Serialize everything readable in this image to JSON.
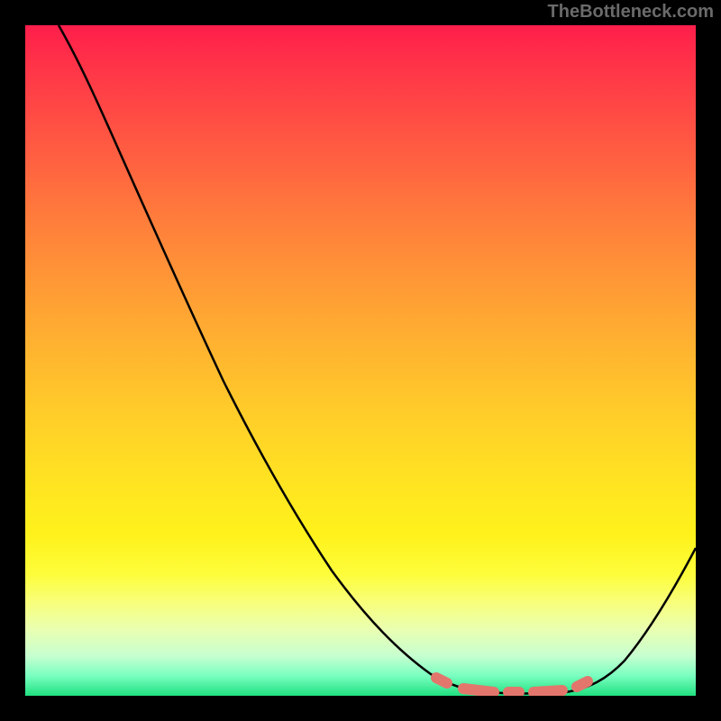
{
  "watermark": "TheBottleneck.com",
  "chart_data": {
    "type": "line",
    "title": "",
    "xlabel": "",
    "ylabel": "",
    "xlim": [
      0,
      100
    ],
    "ylim": [
      0,
      100
    ],
    "grid": false,
    "legend": false,
    "series": [
      {
        "name": "bottleneck-curve",
        "color": "#000000",
        "x": [
          5,
          10,
          15,
          20,
          25,
          30,
          35,
          40,
          45,
          50,
          55,
          60,
          63,
          66,
          70,
          74,
          78,
          82,
          85,
          90,
          95,
          100
        ],
        "values": [
          100,
          93,
          85,
          77,
          69,
          61,
          53,
          45,
          37,
          29,
          21,
          13,
          8,
          5,
          2,
          1,
          1,
          1,
          2,
          7,
          14,
          24
        ]
      }
    ],
    "optimum_band": {
      "x_start": 64,
      "x_end": 84
    },
    "gradient_direction": "vertical",
    "gradient_stops": [
      {
        "pos": 0,
        "color": "#ff1e4b"
      },
      {
        "pos": 50,
        "color": "#ffcd29"
      },
      {
        "pos": 85,
        "color": "#fdfd3c"
      },
      {
        "pos": 100,
        "color": "#20e080"
      }
    ]
  }
}
